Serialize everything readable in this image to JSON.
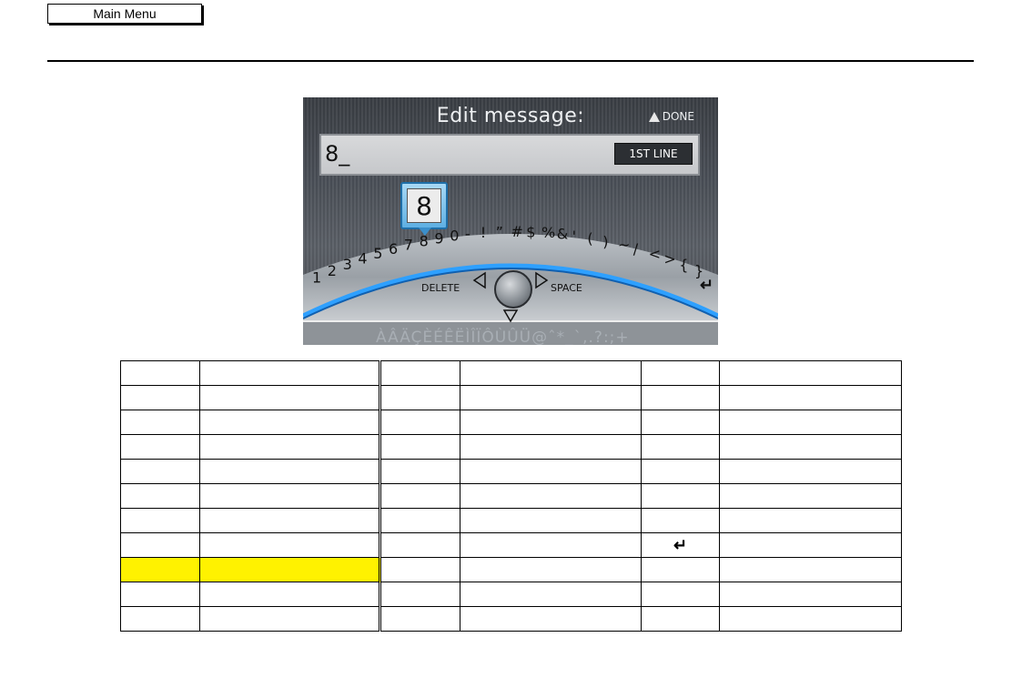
{
  "nav": {
    "main_menu_label": "Main Menu"
  },
  "screen": {
    "title": "Edit message:",
    "done_label": "DONE",
    "input_value": "8_",
    "line_button": "1ST LINE",
    "popup_char": "8",
    "arc_chars": [
      "1",
      "2",
      "3",
      "4",
      "5",
      "6",
      "7",
      "8",
      "9",
      "0",
      "-",
      "!",
      "”",
      "#",
      "$",
      "%",
      "&",
      "'",
      "(",
      ")",
      "~",
      "/",
      "<",
      ">",
      "{",
      "}"
    ],
    "enter_glyph": "↵",
    "delete_label": "DELETE",
    "space_label": "SPACE",
    "accent_row": "ÀÂÄÇÈÉÊËÌÎÏÔÙÛÜ@ˆ*_`,.?:;+"
  },
  "table": {
    "rows": 11,
    "cols": 6,
    "highlight_row": 8,
    "enter_icon_row": 7,
    "enter_icon_col": 5,
    "enter_icon_glyph": "↵",
    "highlight_color": "#fff200"
  }
}
